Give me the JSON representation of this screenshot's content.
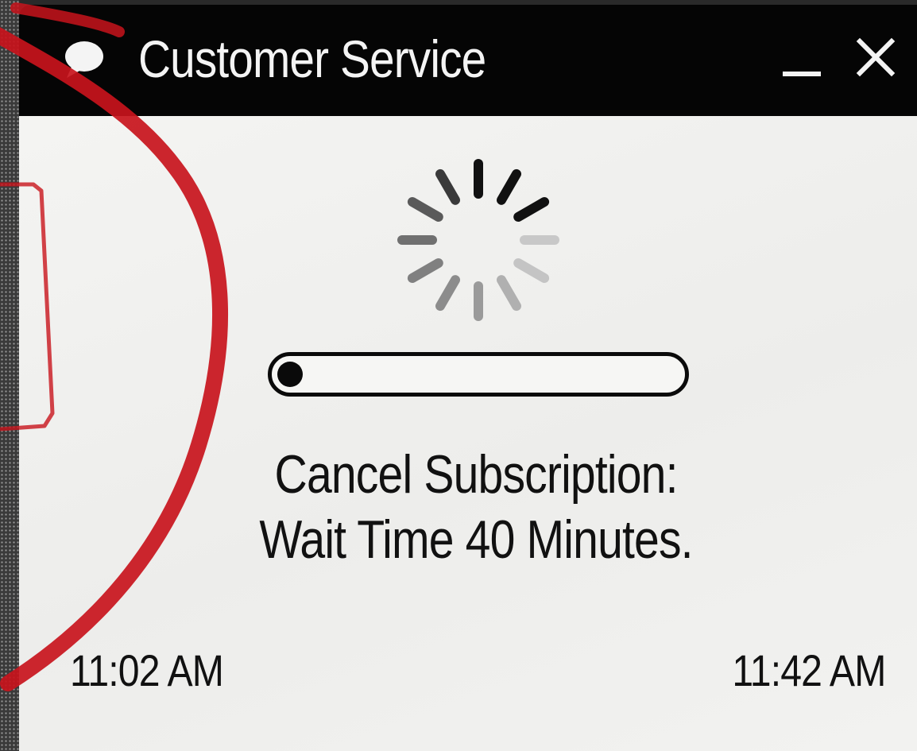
{
  "window": {
    "title": "Customer Service",
    "icon": "chat-icon",
    "minimize_icon": "minimize-icon",
    "close_icon": "close-icon"
  },
  "loading": {
    "spinner_icon": "loading-spinner-icon",
    "progress_fraction": 0.0
  },
  "message": {
    "line1": "Cancel Subscription:",
    "line2": "Wait Time 40 Minutes."
  },
  "times": {
    "start": "11:02 AM",
    "end": "11:42 AM"
  },
  "colors": {
    "titlebar": "#050505",
    "title_text": "#f4f4f4",
    "background": "#f1f1ef",
    "marker_red": "#c8141c"
  }
}
